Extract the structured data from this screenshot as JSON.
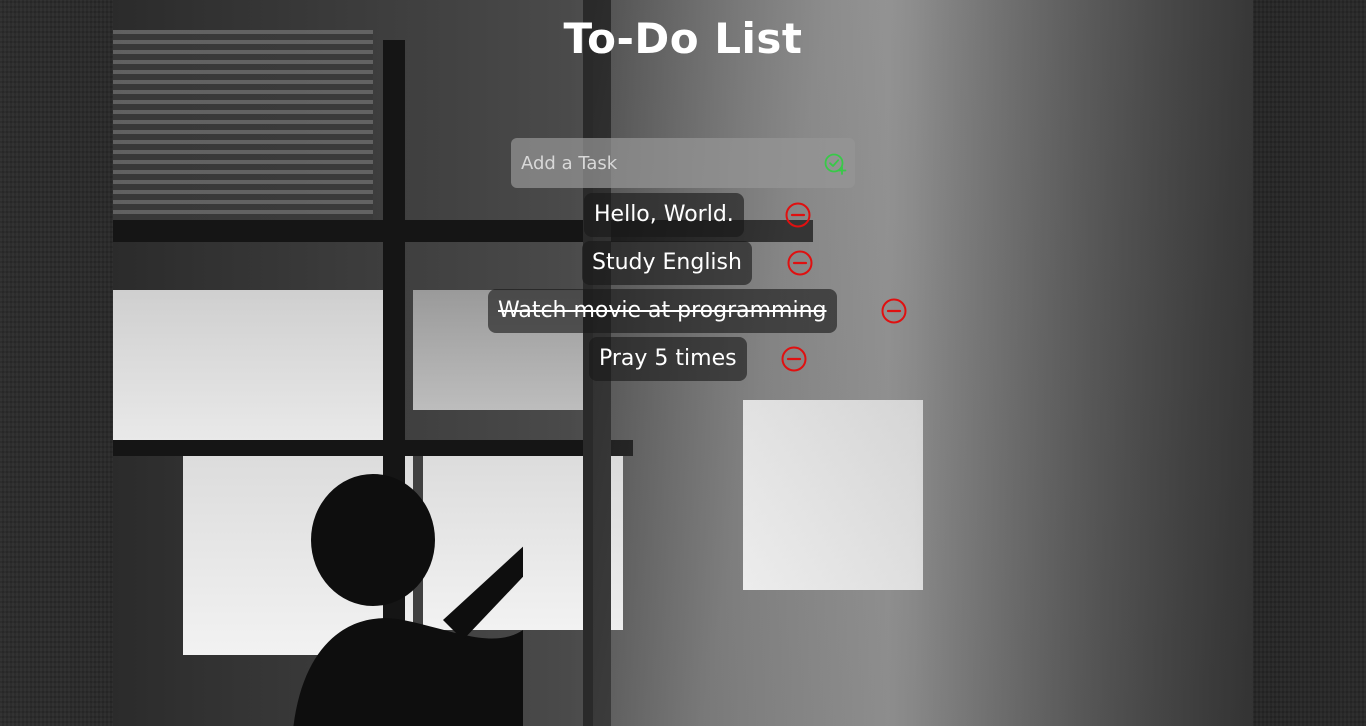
{
  "app": {
    "title": "To-Do List"
  },
  "input": {
    "placeholder": "Add a Task",
    "value": "",
    "add_icon": "circle-check-plus-icon"
  },
  "tasks": [
    {
      "label": "Hello, World.",
      "completed": false,
      "remove_icon": "circle-minus-icon"
    },
    {
      "label": "Study English",
      "completed": false,
      "remove_icon": "circle-minus-icon"
    },
    {
      "label": "Watch movie at programming",
      "completed": true,
      "remove_icon": "circle-minus-icon"
    },
    {
      "label": "Pray 5 times",
      "completed": false,
      "remove_icon": "circle-minus-icon"
    }
  ],
  "colors": {
    "add_icon": "#38c948",
    "remove_icon": "#e01010",
    "title": "#ffffff",
    "input_bg": "#969696",
    "task_bg": "#191919"
  }
}
